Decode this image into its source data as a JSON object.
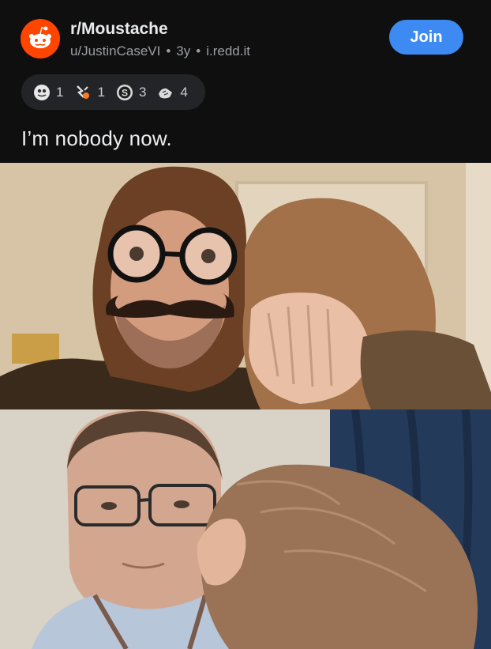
{
  "post": {
    "subreddit": "r/Moustache",
    "author": "u/JustinCaseVI",
    "age": "3y",
    "domain": "i.redd.it",
    "join_label": "Join",
    "title": "I’m nobody now."
  },
  "awards": [
    {
      "icon": "helpful-award-icon",
      "count": "1"
    },
    {
      "icon": "wholesome-award-icon",
      "count": "1"
    },
    {
      "icon": "silver-award-icon",
      "count": "3"
    },
    {
      "icon": "laughing-award-icon",
      "count": "4"
    }
  ],
  "images": {
    "top": "photo-moustache-costume",
    "bottom": "photo-plain-glasses"
  },
  "colors": {
    "join": "#3d8bf2",
    "reddit_orange": "#ff4500",
    "background": "#0f0f10",
    "award_pill": "#232427"
  }
}
